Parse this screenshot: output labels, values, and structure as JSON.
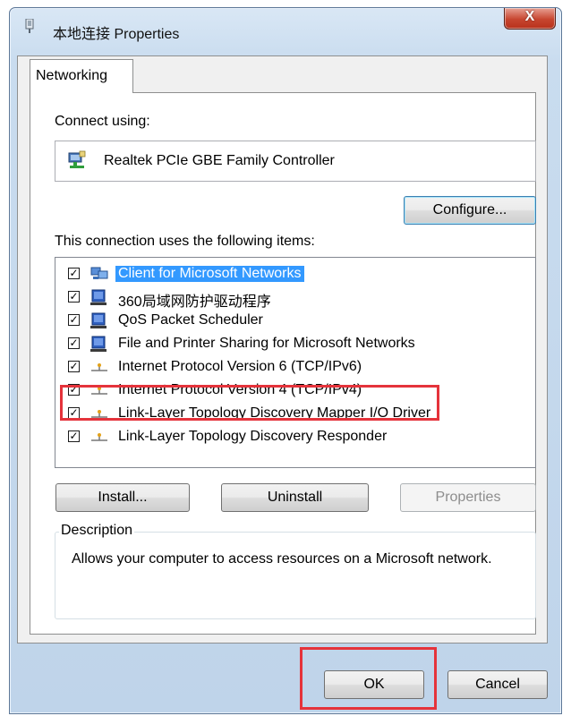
{
  "window": {
    "title": "本地连接 Properties",
    "close_label": "X"
  },
  "tabs": [
    {
      "label": "Networking"
    }
  ],
  "connect_using_label": "Connect using:",
  "adapter_name": "Realtek PCIe GBE Family Controller",
  "configure_button": "Configure...",
  "items_label": "This connection uses the following items:",
  "items": [
    {
      "label": "Client for Microsoft Networks",
      "checked": true,
      "selected": true,
      "icon": "network-client-icon"
    },
    {
      "label": "360局域网防护驱动程序",
      "checked": true,
      "selected": false,
      "icon": "service-icon"
    },
    {
      "label": "QoS Packet Scheduler",
      "checked": true,
      "selected": false,
      "icon": "service-icon"
    },
    {
      "label": "File and Printer Sharing for Microsoft Networks",
      "checked": true,
      "selected": false,
      "icon": "service-icon"
    },
    {
      "label": "Internet Protocol Version 6 (TCP/IPv6)",
      "checked": true,
      "selected": false,
      "icon": "protocol-icon"
    },
    {
      "label": "Internet Protocol Version 4 (TCP/IPv4)",
      "checked": true,
      "selected": false,
      "icon": "protocol-icon"
    },
    {
      "label": "Link-Layer Topology Discovery Mapper I/O Driver",
      "checked": true,
      "selected": false,
      "icon": "protocol-icon"
    },
    {
      "label": "Link-Layer Topology Discovery Responder",
      "checked": true,
      "selected": false,
      "icon": "protocol-icon"
    }
  ],
  "buttons": {
    "install": "Install...",
    "uninstall": "Uninstall",
    "properties": "Properties",
    "ok": "OK",
    "cancel": "Cancel"
  },
  "description": {
    "legend": "Description",
    "text": "Allows your computer to access resources on a Microsoft network."
  },
  "highlight_color": "#e5333b",
  "selection_color": "#3399ff"
}
